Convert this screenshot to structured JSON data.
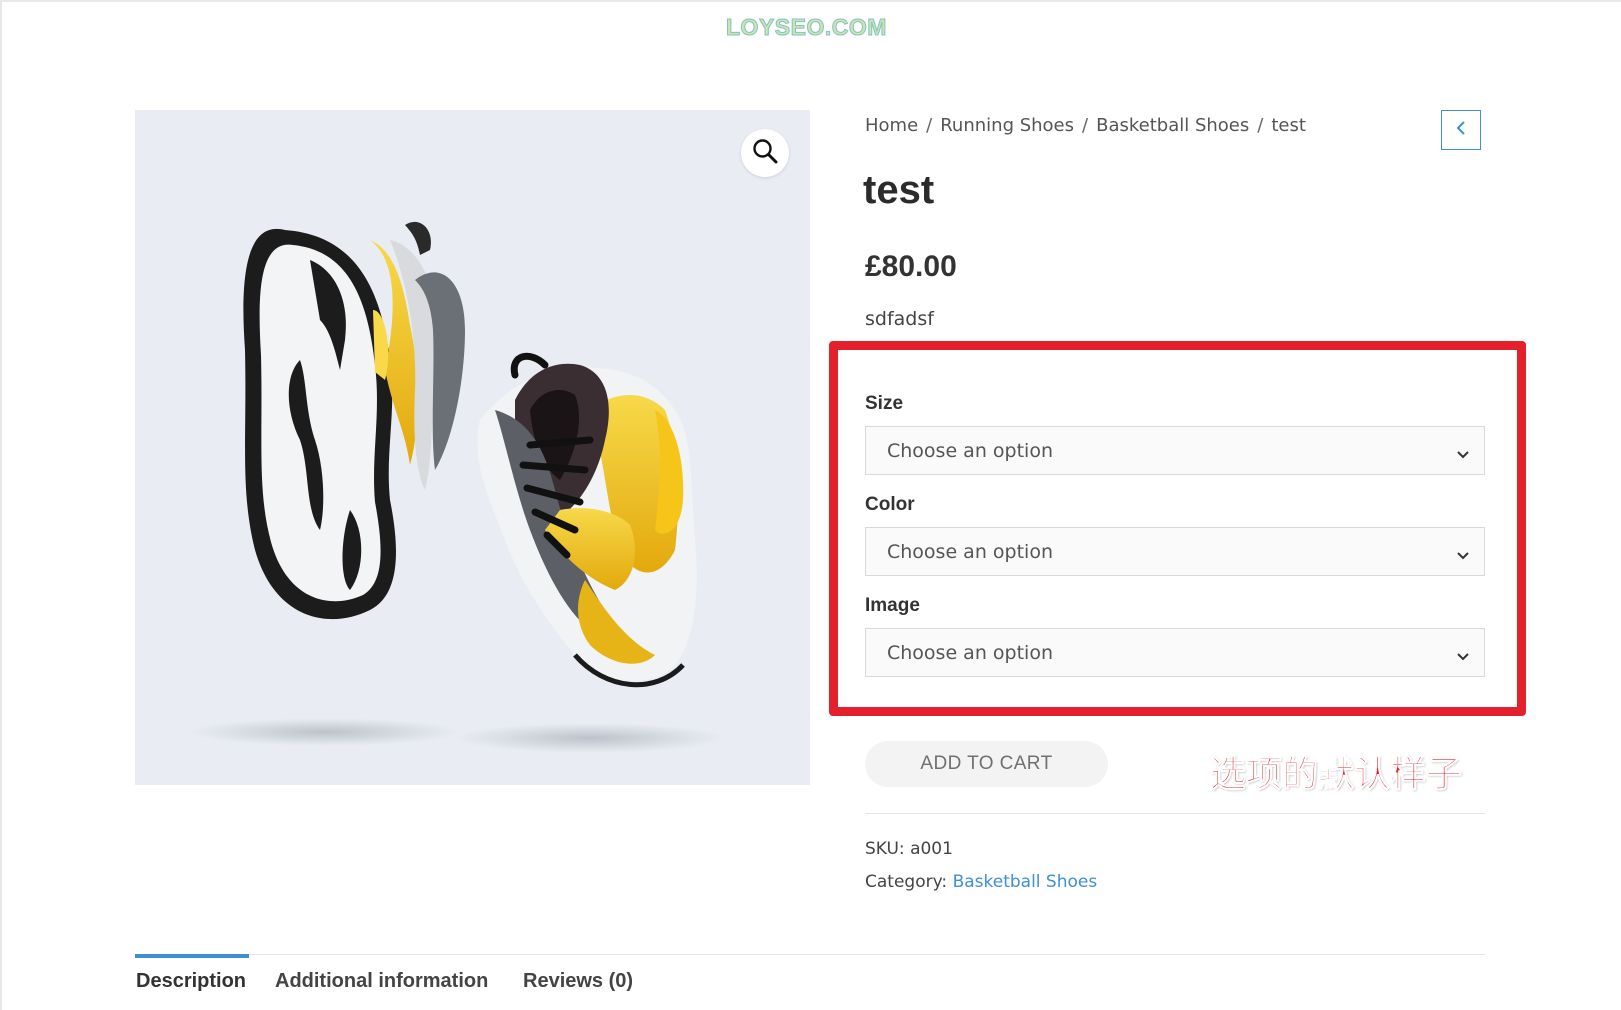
{
  "watermark": "LOYSEO.COM",
  "breadcrumb": {
    "items": [
      "Home",
      "Running Shoes",
      "Basketball Shoes",
      "test"
    ],
    "separator": "/"
  },
  "product": {
    "title": "test",
    "price": "£80.00",
    "short_description": "sdfadsf"
  },
  "variations": [
    {
      "label": "Size",
      "placeholder": "Choose an option"
    },
    {
      "label": "Color",
      "placeholder": "Choose an option"
    },
    {
      "label": "Image",
      "placeholder": "Choose an option"
    }
  ],
  "add_to_cart_label": "ADD TO CART",
  "annotation_text": "选项的默认样子",
  "meta": {
    "sku_label": "SKU:",
    "sku_value": "a001",
    "category_label": "Category:",
    "category_value": "Basketball Shoes"
  },
  "tabs": [
    "Description",
    "Additional information",
    "Reviews (0)"
  ],
  "colors": {
    "accent": "#3e8fd6",
    "highlight_red": "#e3202c",
    "image_background": "#e9edf3",
    "shoe_yellow": "#f2c21b"
  },
  "icons": {
    "zoom": "magnifier-icon",
    "back": "chevron-left-icon",
    "select": "chevron-down-icon"
  }
}
